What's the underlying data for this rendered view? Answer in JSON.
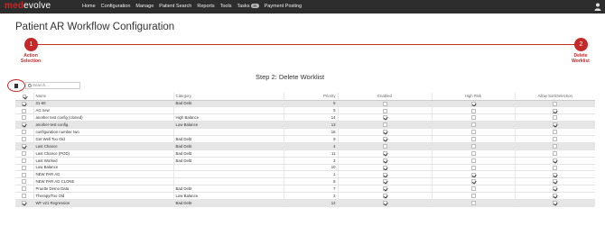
{
  "brand": {
    "part1": "med",
    "part2": "evolve"
  },
  "nav": {
    "items": [
      "Home",
      "Configuration",
      "Manage",
      "Patient Search",
      "Reports",
      "Tools",
      "Tasks",
      "Payment Posting"
    ],
    "tasks_badge": "46"
  },
  "page": {
    "title": "Patient AR Workflow Configuration"
  },
  "wizard": {
    "step1": {
      "number": "1",
      "label_line1": "Action",
      "label_line2": "Selection"
    },
    "step2": {
      "number": "2",
      "label_line1": "Delete",
      "label_line2": "Worklist"
    },
    "current_heading": "Step 2: Delete Worklist"
  },
  "search": {
    "placeholder": "Search..."
  },
  "table": {
    "headers": {
      "name": "Name",
      "category": "Category",
      "priority": "Priority",
      "enabled": "Enabled",
      "high_risk": "High Risk",
      "allow_sort": "Allow Sort/Selection"
    },
    "rows": [
      {
        "selected": true,
        "name": "31-60",
        "category": "Bad Debt",
        "priority": "5",
        "enabled": false,
        "high_risk": true,
        "allow_sort": false
      },
      {
        "selected": false,
        "name": "AG new",
        "category": "",
        "priority": "5",
        "enabled": false,
        "high_risk": false,
        "allow_sort": true
      },
      {
        "selected": false,
        "name": "another test config (cloned)",
        "category": "High Balance",
        "priority": "14",
        "enabled": true,
        "high_risk": false,
        "allow_sort": false
      },
      {
        "selected": true,
        "name": "another-test-config.",
        "category": "Low Balance",
        "priority": "13",
        "enabled": false,
        "high_risk": false,
        "allow_sort": true
      },
      {
        "selected": false,
        "name": "configuration number two",
        "category": "",
        "priority": "16",
        "enabled": true,
        "high_risk": false,
        "allow_sort": false
      },
      {
        "selected": false,
        "name": "Get Well Too Old",
        "category": "Bad Debt",
        "priority": "9",
        "enabled": true,
        "high_risk": false,
        "allow_sort": false
      },
      {
        "selected": true,
        "name": "Last Chance",
        "category": "Bad Debt",
        "priority": "4",
        "enabled": false,
        "high_risk": false,
        "allow_sort": false
      },
      {
        "selected": false,
        "name": "Last Chance (POD)",
        "category": "Bad Debt",
        "priority": "11",
        "enabled": true,
        "high_risk": false,
        "allow_sort": false
      },
      {
        "selected": false,
        "name": "Last Worked",
        "category": "Bad Debt",
        "priority": "3",
        "enabled": true,
        "high_risk": false,
        "allow_sort": true
      },
      {
        "selected": false,
        "name": "Low Balance",
        "category": "",
        "priority": "10",
        "enabled": true,
        "high_risk": false,
        "allow_sort": false
      },
      {
        "selected": false,
        "name": "NEW PAR AG",
        "category": "",
        "priority": "1",
        "enabled": true,
        "high_risk": true,
        "allow_sort": true
      },
      {
        "selected": false,
        "name": "NEW PAR AG CLONE",
        "category": "",
        "priority": "8",
        "enabled": true,
        "high_risk": true,
        "allow_sort": true
      },
      {
        "selected": false,
        "name": "Pruette Demo Data",
        "category": "Bad Debt",
        "priority": "7",
        "enabled": true,
        "high_risk": false,
        "allow_sort": true
      },
      {
        "selected": false,
        "name": "Therapy/Too Old",
        "category": "Low Balance",
        "priority": "2",
        "enabled": true,
        "high_risk": false,
        "allow_sort": true
      },
      {
        "selected": true,
        "name": "WF v21 Regression",
        "category": "Bad Debt",
        "priority": "12",
        "enabled": true,
        "high_risk": false,
        "allow_sort": true
      }
    ]
  },
  "colors": {
    "accent": "#c62828",
    "topbar": "#2d2d2d",
    "selected_row": "#e6e6e6"
  }
}
